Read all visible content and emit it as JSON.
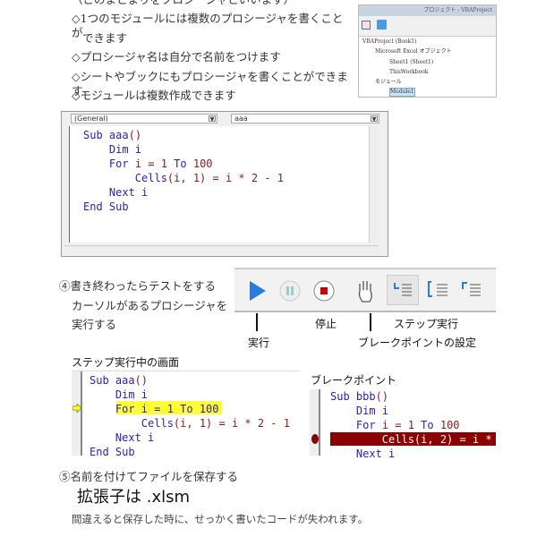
{
  "intro": {
    "cut_line": "（このまとまりをプロシージャといいます）",
    "bullets": [
      "◇1つのモジュールには複数のプロシージャを書くことが",
      "できます",
      "◇プロシージャ名は自分で名前をつけます",
      "◇シートやブックにもプロシージャを書くことができます",
      "◇モジュールは複数作成できます"
    ]
  },
  "project_explorer": {
    "title": "プロジェクト - VBAProject",
    "tree": [
      "VBAProject (Book1)",
      "Microsoft Excel オブジェクト",
      "Sheet1 (Sheet1)",
      "ThisWorkbook",
      "モジュール",
      "Module1"
    ]
  },
  "code_window": {
    "object_select": "(General)",
    "proc_select": "aaa",
    "lines": [
      "Sub aaa()",
      "    Dim i",
      "    For i = 1 To 100",
      "        Cells(i, 1) = i * 2 - 1",
      "    Next i",
      "End Sub"
    ]
  },
  "step4": {
    "lines": [
      "④書き終わったらテストをする",
      "カーソルがあるプロシージャを",
      "実行する"
    ],
    "labels": {
      "run": "実行",
      "stop": "停止",
      "step": "ステップ実行",
      "breakpoint": "ブレークポイントの設定"
    }
  },
  "step_screen": {
    "title": "ステップ実行中の画面",
    "lines": [
      "Sub aaa()",
      "    Dim i",
      "    For i = 1 To 100",
      "        Cells(i, 1) = i * 2 - 1",
      "    Next i",
      "End Sub"
    ],
    "highlight_color": "#ffff33"
  },
  "breakpoint_screen": {
    "title": "ブレークポイント",
    "lines": [
      "Sub bbb()",
      "    Dim i",
      "    For i = 1 To 100",
      "        Cells(i, 2) = i *",
      "    Next i"
    ],
    "highlight_color": "#8b0000"
  },
  "step5": {
    "line": "⑤名前を付けてファイルを保存する",
    "ext": "拡張子は .xlsm",
    "note": "間違えると保存した時に、せっかく書いたコードが失われます。"
  }
}
